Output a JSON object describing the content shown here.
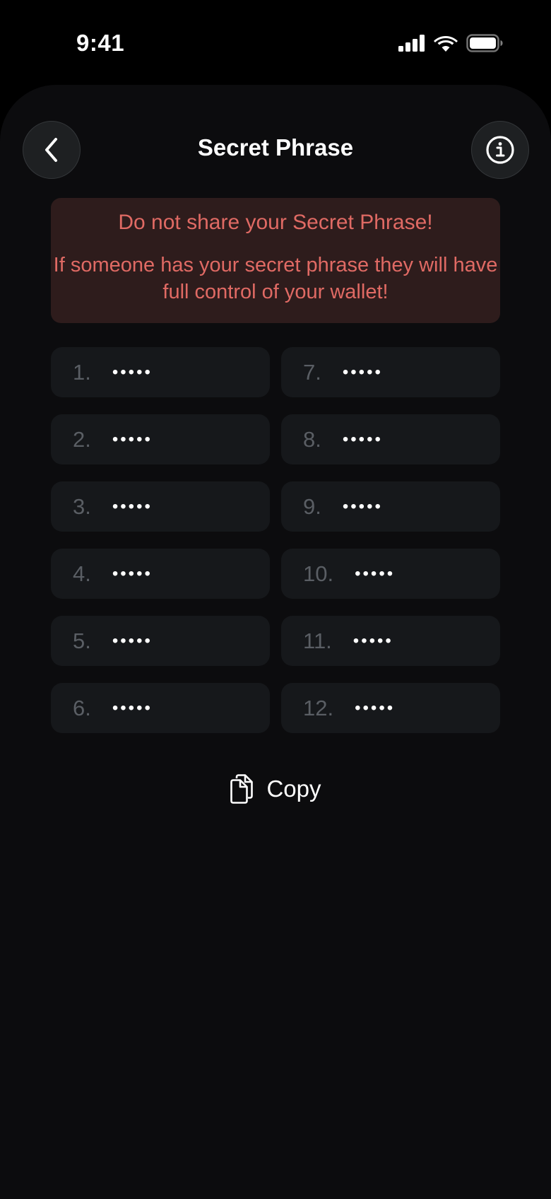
{
  "status_bar": {
    "time": "9:41",
    "icons": [
      "cellular-signal-icon",
      "wifi-icon",
      "battery-icon"
    ]
  },
  "header": {
    "title": "Secret Phrase",
    "back_icon": "chevron-left-icon",
    "info_icon": "info-icon"
  },
  "warning": {
    "title": "Do not share your Secret Phrase!",
    "body": "If someone has your secret phrase they will have full control of your wallet!"
  },
  "words": [
    {
      "number": "1.",
      "mask": "•••••"
    },
    {
      "number": "7.",
      "mask": "•••••"
    },
    {
      "number": "2.",
      "mask": "•••••"
    },
    {
      "number": "8.",
      "mask": "•••••"
    },
    {
      "number": "3.",
      "mask": "•••••"
    },
    {
      "number": "9.",
      "mask": "•••••"
    },
    {
      "number": "4.",
      "mask": "•••••"
    },
    {
      "number": "10.",
      "mask": "•••••"
    },
    {
      "number": "5.",
      "mask": "•••••"
    },
    {
      "number": "11.",
      "mask": "•••••"
    },
    {
      "number": "6.",
      "mask": "•••••"
    },
    {
      "number": "12.",
      "mask": "•••••"
    }
  ],
  "copy": {
    "label": "Copy",
    "icon": "copy-icon"
  },
  "colors": {
    "background": "#0c0c0e",
    "warning_bg": "#2e1c1c",
    "warning_text": "#e06a64",
    "cell_bg": "#16181b",
    "number_text": "#5a5e64"
  }
}
